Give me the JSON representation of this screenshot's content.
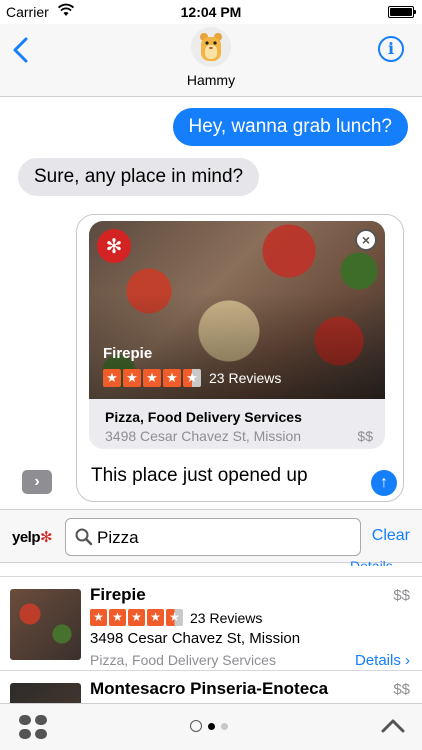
{
  "status_bar": {
    "carrier": "Carrier",
    "time": "12:04 PM"
  },
  "nav": {
    "contact_name": "Hammy",
    "info_label": "i"
  },
  "messages": [
    {
      "direction": "outgoing",
      "text": "Hey, wanna grab lunch?"
    },
    {
      "direction": "incoming",
      "text": "Sure, any place in mind?"
    }
  ],
  "compose": {
    "card": {
      "name": "Firepie",
      "rating": 4.5,
      "reviews": "23 Reviews",
      "categories": "Pizza, Food Delivery Services",
      "address": "3498 Cesar Chavez St, Mission",
      "price": "$$"
    },
    "message": "This place just opened up"
  },
  "search": {
    "logo": "yelp",
    "query": "Pizza",
    "clear_label": "Clear"
  },
  "results_peek": "Details",
  "results": [
    {
      "name": "Firepie",
      "price": "$$",
      "rating": 4.5,
      "reviews": "23 Reviews",
      "address": "3498 Cesar Chavez St, Mission",
      "categories": "Pizza, Food Delivery Services",
      "details_label": "Details ›"
    },
    {
      "name": "Montesacro Pinseria-Enoteca",
      "price": "$$"
    }
  ],
  "colors": {
    "accent": "#157efb",
    "yelp_red": "#d32323",
    "star_orange": "#f15c2b",
    "bubble_gray": "#e5e5ea"
  },
  "icons": [
    "back-chevron-icon",
    "info-icon",
    "hamster-avatar-icon",
    "yelp-burst-icon",
    "close-icon",
    "send-arrow-icon",
    "expand-chevron-icon",
    "search-icon",
    "app-drawer-icon",
    "recent-clock-icon",
    "chevron-up-icon"
  ]
}
